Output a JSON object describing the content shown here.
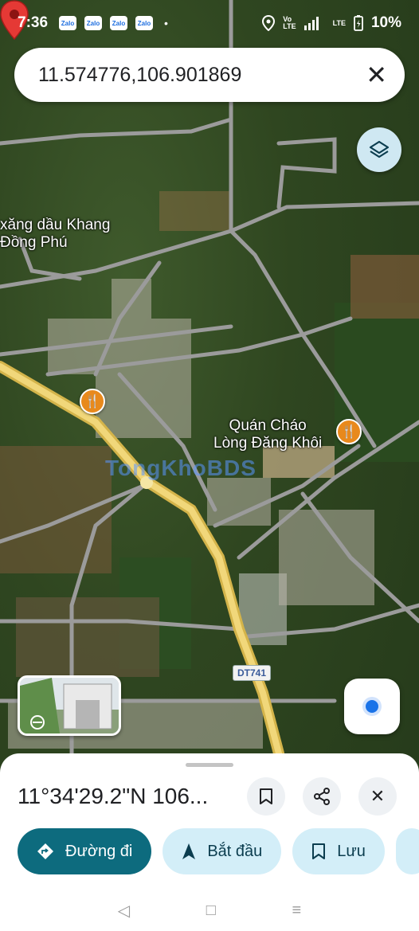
{
  "status_bar": {
    "time": "7:36",
    "notifications": [
      "Zalo",
      "Zalo",
      "Zalo",
      "Zalo"
    ],
    "dot": "•",
    "network": "LTE",
    "battery": "10%"
  },
  "search": {
    "query": "11.574776,106.901869",
    "close_icon": "close-icon"
  },
  "map": {
    "labels": {
      "gas_station": "xăng dầu Khang Đồng Phú",
      "gas_station_line1": "xăng dầu Khang",
      "gas_station_line2": "Đồng Phú",
      "restaurant_line1": "Quán Cháo",
      "restaurant_line2": "Lòng Đăng Khôi"
    },
    "road_shield": "DT741",
    "watermark": "TongKhoBDS",
    "poi_icon": "restaurant-icon",
    "pin_color": "#e53935"
  },
  "place": {
    "title": "11°34'29.2\"N 106..."
  },
  "actions": {
    "directions": "Đường đi",
    "start": "Bắt đầu",
    "save": "Lưu"
  },
  "colors": {
    "primary_chip": "#0d6b7e",
    "secondary_chip": "#d3eef8",
    "poi": "#e8891c"
  }
}
